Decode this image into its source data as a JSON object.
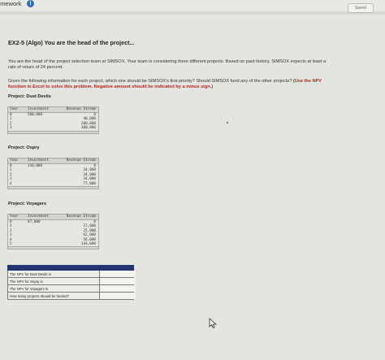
{
  "header": {
    "title": "omework",
    "saved_label": "Saved"
  },
  "question": {
    "title": "EX2-5 (Algo) You are the head of the project...",
    "intro": "You are the head of the project selection team at SIMSOX. Your team is considering three different projects. Based on past history, SIMSOX expects at least a rate of return of 24 percent.",
    "prompt": "Given the following information for each project, which one should be SIMSOX's first priority? Should SIMSOX fund any of the other projects?",
    "instruction": "(Use the NPV function in Excel to solve this problem. Negative amount should be indicated by a minus sign.)"
  },
  "table_headers": {
    "year": "Year",
    "investment": "Investment",
    "revenue": "Revenue Stream"
  },
  "projects": [
    {
      "label": "Project: Dust Devils",
      "rows": [
        {
          "year": "0",
          "investment": "560,000",
          "revenue": "0"
        },
        {
          "year": "1",
          "investment": "",
          "revenue": "40,000"
        },
        {
          "year": "2",
          "investment": "",
          "revenue": "280,000"
        },
        {
          "year": "3",
          "investment": "",
          "revenue": "300,000"
        }
      ]
    },
    {
      "label": "Project: Ospry",
      "rows": [
        {
          "year": "0",
          "investment": "310,000",
          "revenue": "0"
        },
        {
          "year": "1",
          "investment": "",
          "revenue": "34,000"
        },
        {
          "year": "2",
          "investment": "",
          "revenue": "34,000"
        },
        {
          "year": "3",
          "investment": "",
          "revenue": "34,000"
        },
        {
          "year": "4",
          "investment": "",
          "revenue": "77,000"
        }
      ]
    },
    {
      "label": "Project: Voyagers",
      "rows": [
        {
          "year": "0",
          "investment": "87,000",
          "revenue": "0"
        },
        {
          "year": "1",
          "investment": "",
          "revenue": "27,000"
        },
        {
          "year": "2",
          "investment": "",
          "revenue": "25,000"
        },
        {
          "year": "3",
          "investment": "",
          "revenue": "62,000"
        },
        {
          "year": "4",
          "investment": "",
          "revenue": "56,000"
        },
        {
          "year": "5",
          "investment": "",
          "revenue": "144,000"
        }
      ]
    }
  ],
  "answers": [
    {
      "label": "The NPV for Dust Devils is",
      "value": ""
    },
    {
      "label": "The NPV for Ospry is",
      "value": ""
    },
    {
      "label": "The NPV for Voyagers is",
      "value": ""
    },
    {
      "label": "How many projects should be funded?",
      "value": ""
    }
  ],
  "colors": {
    "answer_header": "#22356e",
    "instruction_red": "#b3261e",
    "info_blue": "#2a6fb8"
  }
}
